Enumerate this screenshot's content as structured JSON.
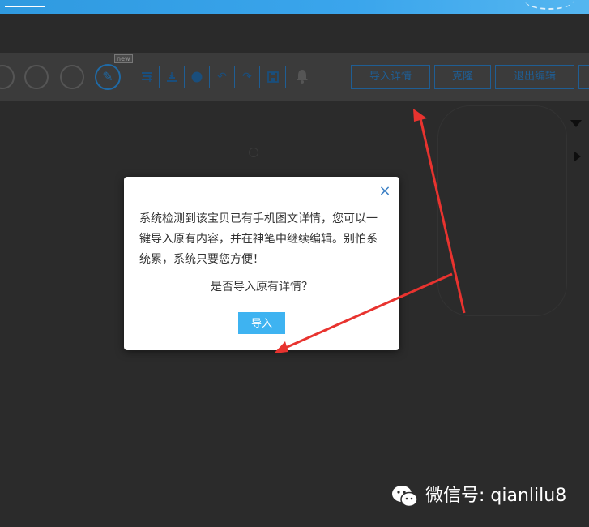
{
  "toolbar": {
    "new_tag": "new",
    "import_details_button": "导入详情",
    "clone_button": "克隆",
    "exit_edit_button": "退出编辑"
  },
  "modal": {
    "message": "系统检测到该宝贝已有手机图文详情，您可以一键导入原有内容，并在神笔中继续编辑。别怕系统累，系统只要您方便！",
    "question": "是否导入原有详情？",
    "import_button": "导入",
    "close_glyph": "×"
  },
  "watermark": {
    "text": "微信号: qianlilu8"
  },
  "icons": {
    "pen": "✎",
    "undo": "↶",
    "redo": "↷",
    "bell": "🔔"
  },
  "colors": {
    "accent_blue": "#3eb3f1",
    "toolbar_blue": "#1f5e94",
    "annotation_red": "#e8332f",
    "overlay": "#2c2c2c"
  }
}
